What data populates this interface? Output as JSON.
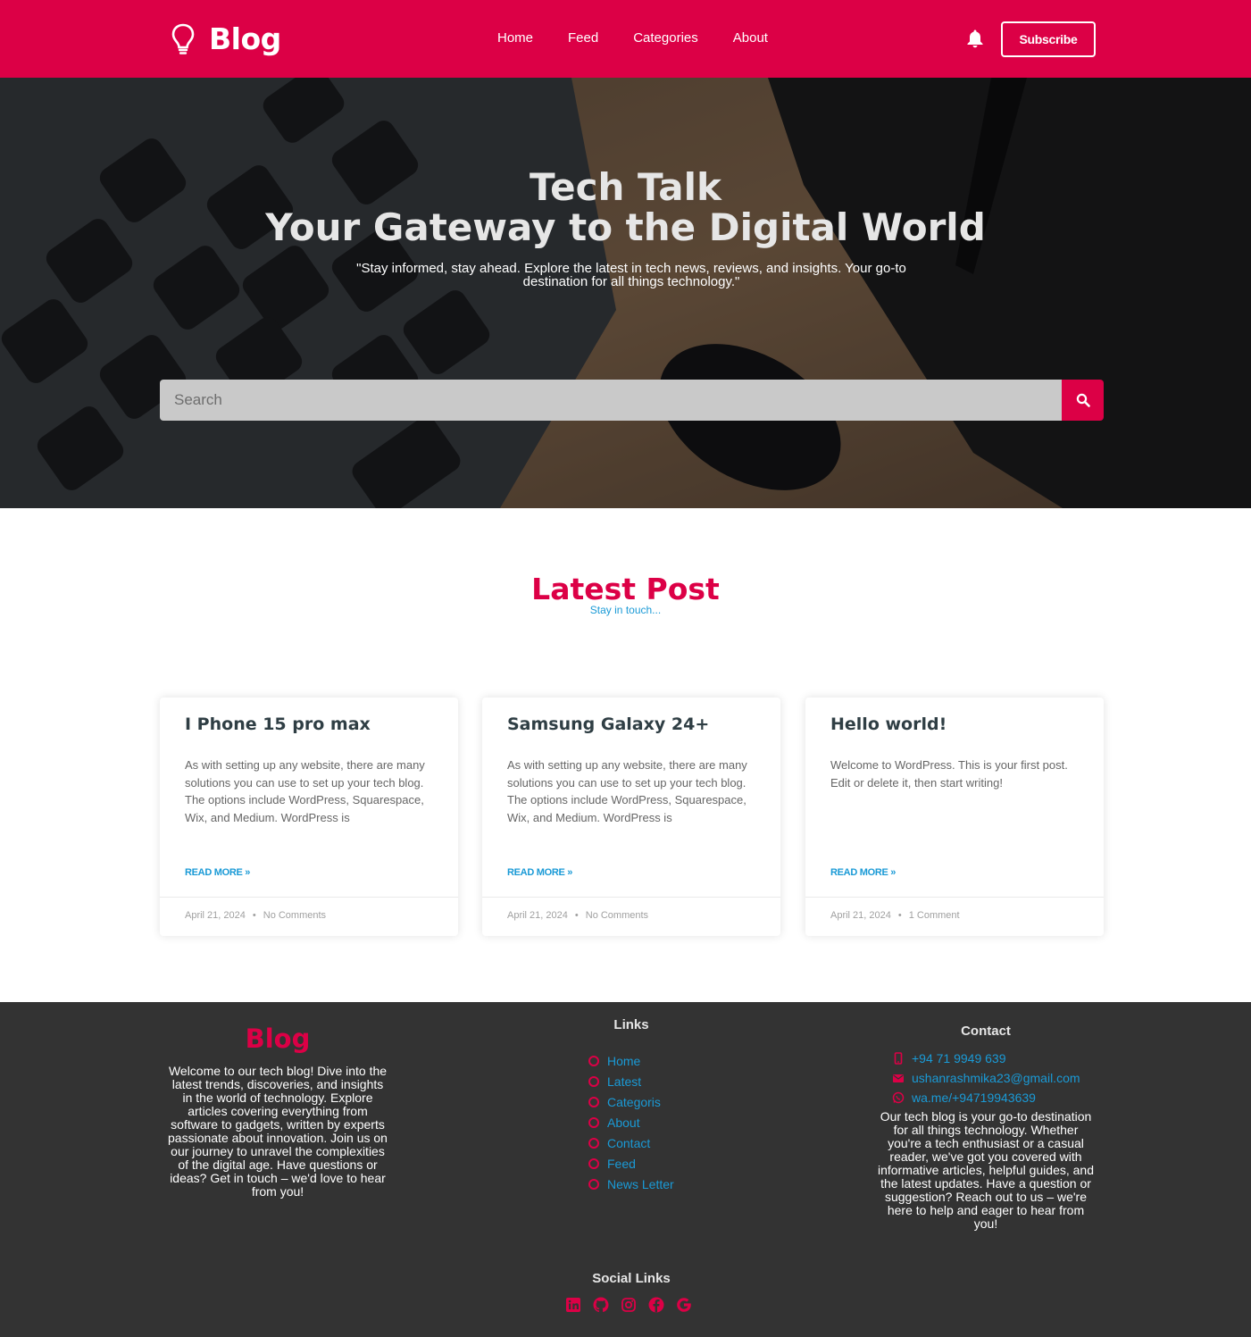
{
  "header": {
    "logo_text": "Blog",
    "nav": [
      "Home",
      "Feed",
      "Categories",
      "About"
    ],
    "subscribe_label": "Subscribe"
  },
  "hero": {
    "title_line1": "Tech Talk",
    "title_line2": "Your Gateway to the Digital World",
    "subtitle": "\"Stay informed, stay ahead. Explore the latest in tech news, reviews, and insights. Your go-to destination for all things technology.\"",
    "search_placeholder": "Search"
  },
  "latest": {
    "title": "Latest Post",
    "subtitle": "Stay in touch..."
  },
  "posts": [
    {
      "title": "I Phone 15 pro max",
      "excerpt": "As with setting up any website, there are many solutions you can use to set up your tech blog. The options include WordPress, Squarespace, Wix, and Medium. WordPress is",
      "read_more": "READ MORE »",
      "date": "April 21, 2024",
      "comments": "No Comments"
    },
    {
      "title": "Samsung Galaxy 24+",
      "excerpt": "As with setting up any website, there are many solutions you can use to set up your tech blog. The options include WordPress, Squarespace, Wix, and Medium. WordPress is",
      "read_more": "READ MORE »",
      "date": "April 21, 2024",
      "comments": "No Comments"
    },
    {
      "title": "Hello world!",
      "excerpt": "Welcome to WordPress. This is your first post. Edit or delete it, then start writing!",
      "read_more": "READ MORE »",
      "date": "April 21, 2024",
      "comments": "1 Comment"
    }
  ],
  "footer": {
    "brand": "Blog",
    "about": "Welcome to our tech blog! Dive into the latest trends, discoveries, and insights in the world of technology. Explore articles covering everything from software to gadgets, written by experts passionate about innovation. Join us on our journey to unravel the complexities of the digital age. Have questions or ideas? Get in touch – we'd love to hear from you!",
    "links_heading": "Links",
    "links": [
      "Home",
      "Latest",
      "Categoris",
      "About",
      "Contact",
      "Feed",
      "News Letter"
    ],
    "contact_heading": "Contact",
    "contact": {
      "phone": "+94 71 9949 639",
      "email": "ushanrashmika23@gmail.com",
      "whatsapp": "wa.me/+94719943639"
    },
    "contact_text": "Our tech blog is your go-to destination for all things technology. Whether you're a tech enthusiast or a casual reader, we've got you covered with informative articles, helpful guides, and the latest updates. Have a question or suggestion? Reach out to us – we're here to help and eager to hear from you!",
    "social_heading": "Social Links",
    "social_icons": [
      "linkedin-icon",
      "github-icon",
      "instagram-icon",
      "facebook-icon",
      "google-icon"
    ]
  },
  "colors": {
    "brand": "#dc0046",
    "link": "#1a9ad6",
    "footer_bg": "#333333"
  }
}
